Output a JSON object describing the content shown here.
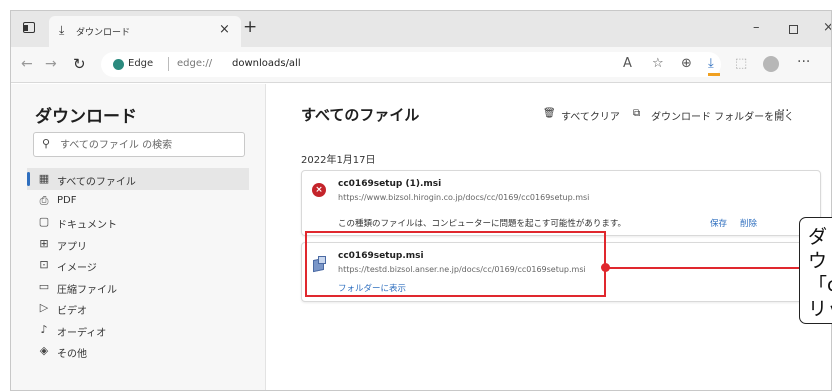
{
  "titlebar": {
    "tab_title": "ダウンロード",
    "tab_close": "×",
    "new_tab": "+",
    "min": "–",
    "close": "×"
  },
  "addressbar": {
    "edge_label": "Edge",
    "url_prefix": "edge://",
    "url_path": "downloads/all",
    "more": "···"
  },
  "sidebar": {
    "title": "ダウンロード",
    "search_placeholder": "すべてのファイル の検索",
    "items": [
      {
        "label": "すべてのファイル",
        "icon": "grid-icon",
        "glyph": "▦",
        "selected": true
      },
      {
        "label": "PDF",
        "icon": "pdf-icon",
        "glyph": "⎙",
        "selected": false
      },
      {
        "label": "ドキュメント",
        "icon": "document-icon",
        "glyph": "▢",
        "selected": false
      },
      {
        "label": "アプリ",
        "icon": "apps-icon",
        "glyph": "⊞",
        "selected": false
      },
      {
        "label": "イメージ",
        "icon": "image-icon",
        "glyph": "⊡",
        "selected": false
      },
      {
        "label": "圧縮ファイル",
        "icon": "archive-icon",
        "glyph": "▭",
        "selected": false
      },
      {
        "label": "ビデオ",
        "icon": "video-icon",
        "glyph": "▷",
        "selected": false
      },
      {
        "label": "オーディオ",
        "icon": "audio-icon",
        "glyph": "♪",
        "selected": false
      },
      {
        "label": "その他",
        "icon": "other-icon",
        "glyph": "◈",
        "selected": false
      }
    ]
  },
  "main": {
    "title": "すべてのファイル",
    "clear_all": "すべてクリア",
    "open_folder": "ダウンロード フォルダーを開く",
    "more": "···",
    "date": "2022年1月17日"
  },
  "downloads": [
    {
      "filename": "cc0169setup (1).msi",
      "url": "https://www.bizsol.hirogin.co.jp/docs/cc/0169/cc0169setup.msi",
      "warning": "この種類のファイルは、コンピューターに問題を起こす可能性があります。",
      "save_label": "保存",
      "delete_label": "削除"
    },
    {
      "filename": "cc0169setup.msi",
      "url": "https://testd.bizsol.anser.ne.jp/docs/cc/0169/cc0169setup.msi",
      "show_in_folder": "フォルダーに表示"
    }
  ],
  "annotation": {
    "callout_text": "ダ\nウ\n「c\nリッ"
  },
  "colors": {
    "accent": "#2f6fbf",
    "annotation_red": "#e0282e",
    "error_red": "#c4242b"
  }
}
